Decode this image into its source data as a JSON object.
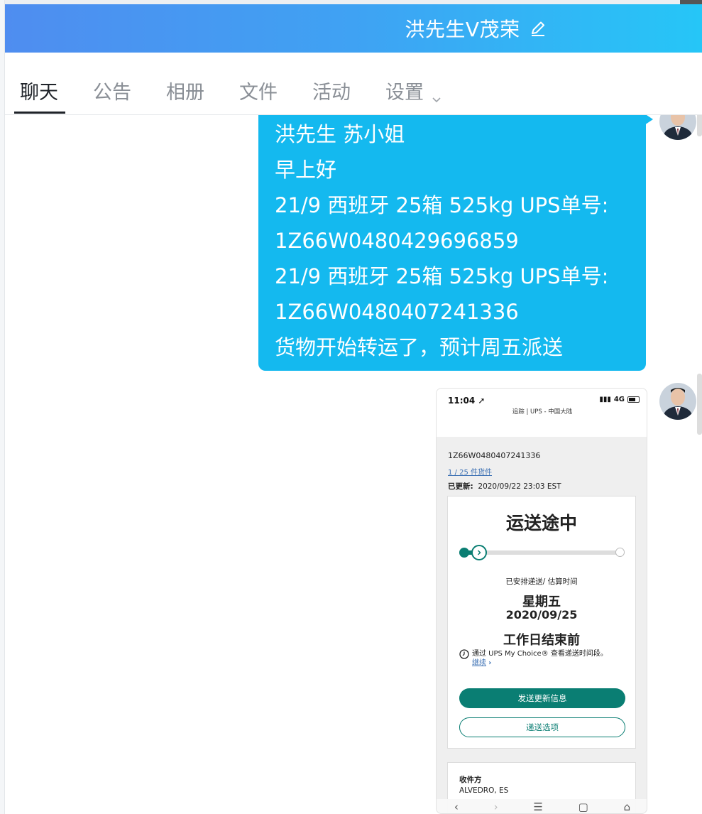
{
  "window": {
    "title": "洪先生V茂荣"
  },
  "tabs": [
    {
      "label": "聊天"
    },
    {
      "label": "公告"
    },
    {
      "label": "相册"
    },
    {
      "label": "文件"
    },
    {
      "label": "活动"
    },
    {
      "label": "设置"
    }
  ],
  "message": {
    "lines": [
      "洪先生 苏小姐",
      "早上好",
      "21/9 西班牙 25箱  525kg UPS单号:",
      "1Z66W0480429696859",
      "21/9 西班牙 25箱  525kg UPS单号:",
      "1Z66W0480407241336",
      "货物开始转运了，预计周五派送"
    ],
    "bubble_color": "#14b9ef"
  },
  "screenshot": {
    "time": "11:04",
    "network": "4G",
    "page_title": "追踪 | UPS - 中国大陆",
    "tracking_number": "1Z66W0480407241336",
    "pieces": "1 / 25 件货件",
    "updated_label": "已更新:",
    "updated_value": "2020/09/22 23:03 EST",
    "status": "运送途中",
    "progress": 0.15,
    "eta_label": "已安排递送/ 估算时间",
    "eta_day": "星期五",
    "eta_date": "2020/09/25",
    "eta_end": "工作日结束前",
    "choice_text": "通过 UPS My Choice® 查看递送时间段。",
    "choice_link": "继续",
    "send_updates": "发送更新信息",
    "delivery_options": "递送选项",
    "recipient_label": "收件方",
    "recipient_value": "ALVEDRO, ES",
    "accent_color": "#0a7e73"
  }
}
